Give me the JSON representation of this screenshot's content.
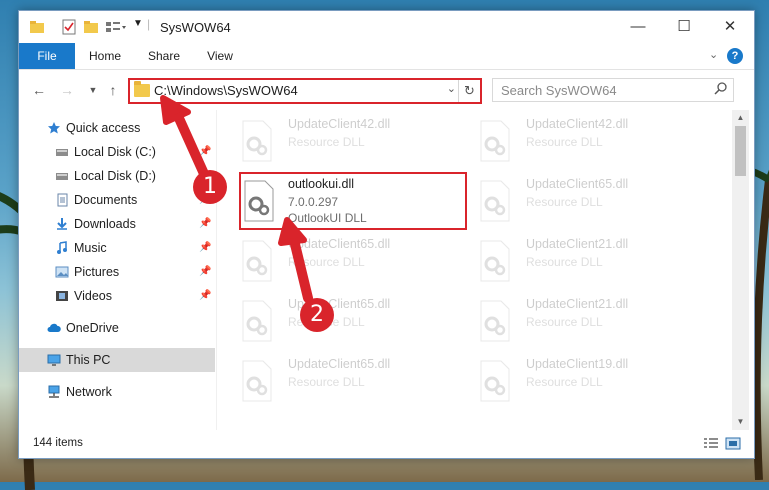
{
  "window": {
    "title": "SysWOW64",
    "controls": {
      "minimize": "—",
      "maximize": "☐",
      "close": "✕"
    }
  },
  "ribbon": {
    "tabs": [
      "File",
      "Home",
      "Share",
      "View"
    ],
    "help_label": "?"
  },
  "navigation": {
    "address_path": "C:\\Windows\\SysWOW64",
    "search_placeholder": "Search SysWOW64"
  },
  "sidebar": {
    "items": [
      {
        "label": "Quick access",
        "icon": "star-icon",
        "pinned": false
      },
      {
        "label": "Local Disk (C:)",
        "icon": "drive-icon",
        "pinned": true
      },
      {
        "label": "Local Disk (D:)",
        "icon": "drive-icon",
        "pinned": false
      },
      {
        "label": "Documents",
        "icon": "documents-icon",
        "pinned": true
      },
      {
        "label": "Downloads",
        "icon": "download-arrow-icon",
        "pinned": true
      },
      {
        "label": "Music",
        "icon": "music-note-icon",
        "pinned": true
      },
      {
        "label": "Pictures",
        "icon": "pictures-icon",
        "pinned": true
      },
      {
        "label": "Videos",
        "icon": "videos-icon",
        "pinned": true
      },
      {
        "label": "OneDrive",
        "icon": "cloud-icon",
        "pinned": false
      },
      {
        "label": "This PC",
        "icon": "computer-icon",
        "pinned": false,
        "selected": true
      },
      {
        "label": "Network",
        "icon": "network-icon",
        "pinned": false
      }
    ]
  },
  "files": [
    {
      "name": "UpdateClient42.dll",
      "type": "Resource DLL"
    },
    {
      "name": "UpdateClient42.dll",
      "type": "Resource DLL"
    },
    {
      "name": "outlookui.dll",
      "version": "7.0.0.297",
      "type": "OutlookUI DLL",
      "highlighted": true
    },
    {
      "name": "UpdateClient65.dll",
      "type": "Resource DLL"
    },
    {
      "name": "UpdateClient65.dll",
      "type": "Resource DLL"
    },
    {
      "name": "UpdateClient21.dll",
      "type": "Resource DLL"
    },
    {
      "name": "UpdateClient65.dll",
      "type": "Resource DLL"
    },
    {
      "name": "UpdateClient21.dll",
      "type": "Resource DLL"
    },
    {
      "name": "UpdateClient65.dll",
      "type": "Resource DLL"
    },
    {
      "name": "UpdateClient19.dll",
      "type": "Resource DLL"
    }
  ],
  "status": {
    "item_count": "144 items"
  },
  "annotations": {
    "step1": "1",
    "step2": "2"
  },
  "colors": {
    "accent": "#1979ca",
    "highlight": "#d9242b",
    "folder": "#f2c94c"
  }
}
